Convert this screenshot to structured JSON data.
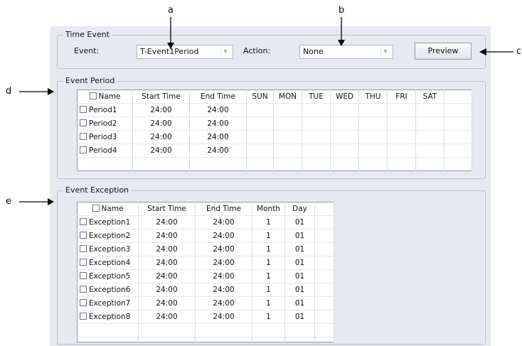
{
  "callouts": {
    "a": "a",
    "b": "b",
    "c": "c",
    "d": "d",
    "e": "e"
  },
  "time_event": {
    "title": "Time Event",
    "event_label": "Event:",
    "event_value": "T-Event1Period",
    "action_label": "Action:",
    "action_value": "None",
    "preview_label": "Preview"
  },
  "event_period": {
    "title": "Event Period",
    "columns": [
      "Name",
      "Start Time",
      "End Time",
      "SUN",
      "MON",
      "TUE",
      "WED",
      "THU",
      "FRI",
      "SAT"
    ],
    "rows": [
      {
        "name": "Period1",
        "start": "24:00",
        "end": "24:00"
      },
      {
        "name": "Period2",
        "start": "24:00",
        "end": "24:00"
      },
      {
        "name": "Period3",
        "start": "24:00",
        "end": "24:00"
      },
      {
        "name": "Period4",
        "start": "24:00",
        "end": "24:00"
      }
    ]
  },
  "event_exception": {
    "title": "Event Exception",
    "columns": [
      "Name",
      "Start Time",
      "End Time",
      "Month",
      "Day"
    ],
    "rows": [
      {
        "name": "Exception1",
        "start": "24:00",
        "end": "24:00",
        "month": "1",
        "day": "01"
      },
      {
        "name": "Exception2",
        "start": "24:00",
        "end": "24:00",
        "month": "1",
        "day": "01"
      },
      {
        "name": "Exception3",
        "start": "24:00",
        "end": "24:00",
        "month": "1",
        "day": "01"
      },
      {
        "name": "Exception4",
        "start": "24:00",
        "end": "24:00",
        "month": "1",
        "day": "01"
      },
      {
        "name": "Exception5",
        "start": "24:00",
        "end": "24:00",
        "month": "1",
        "day": "01"
      },
      {
        "name": "Exception6",
        "start": "24:00",
        "end": "24:00",
        "month": "1",
        "day": "01"
      },
      {
        "name": "Exception7",
        "start": "24:00",
        "end": "24:00",
        "month": "1",
        "day": "01"
      },
      {
        "name": "Exception8",
        "start": "24:00",
        "end": "24:00",
        "month": "1",
        "day": "01"
      }
    ]
  }
}
